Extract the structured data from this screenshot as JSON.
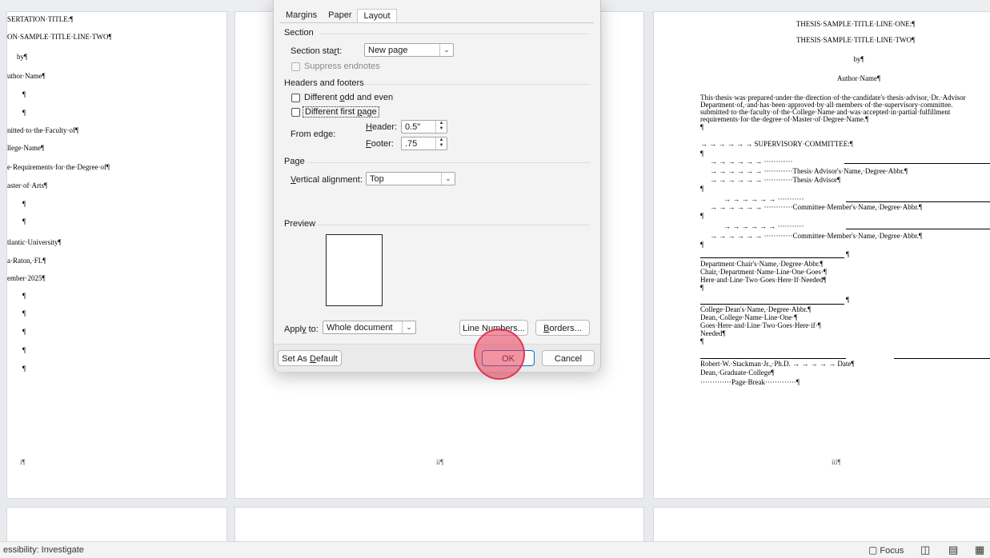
{
  "left_page": {
    "lines": [
      "SERTATION·TITLE:¶",
      "ON·SAMPLE·TITLE·LINE·TWO¶",
      "by¶",
      "uthor·Name¶",
      "¶",
      "¶",
      "nitted·to·the·Faculty·of¶",
      "llege·Name¶",
      "e·Requirements·for·the·Degree·of¶",
      "aster·of·Arts¶",
      "¶",
      "¶",
      "tlantic·University¶",
      "a·Raton,·FL¶",
      "ember·2025¶",
      "¶",
      "¶",
      "¶",
      "¶",
      "¶"
    ],
    "page_number": "i¶"
  },
  "middle_page": {
    "page_number": "ii¶"
  },
  "right_page": {
    "title1": "THESIS·SAMPLE·TITLE·LINE·ONE:¶",
    "title2": "THESIS·SAMPLE·TITLE·LINE·TWO¶",
    "by": "by¶",
    "author": "Author·Name¶",
    "para": [
      "This·thesis·was·prepared·under·the·direction·of·the·candidate's·thesis·advisor,·Dr.·Advisor",
      "Department·of,·and·has·been·approved·by·all·members·of·the·supervisory·committee.",
      "submitted·to·the·faculty·of·the·College·Name·and·was·accepted·in·partial·fulfillment",
      "requirements·for·the·degree·of·Master·of·Degree·Name.¶"
    ],
    "pilcrow": "¶",
    "committee": "→    →    →    →    →    →    SUPERVISORY·COMMITTEE:¶",
    "tabs_dots": "→    →    →    →    →    →    ············",
    "advisor": "→    →    →    →    →    →    ············Thesis·Advisor's·Name,·Degree·Abbr.¶",
    "advisor2": "→    →    →    →    →    →    ············Thesis·Advisor¶",
    "member_dots": "→    →    →    →    →    →    ···········",
    "member": "→    →    →    →    →    →    ············Committee·Member's·Name,·Degree·Abbr.¶",
    "dept_chair": [
      "Department·Chair's·Name,·Degree·Abbr.¶",
      "Chair,·Department·Name·Line·One·Goes·¶",
      "Here·and·Line·Two·Goes·Here·If·Needed¶"
    ],
    "dean": [
      "College·Dean's·Name,·Degree·Abbr.¶",
      "Dean,·College·Name·Line·One·¶",
      "Goes·Here·and·Line·Two·Goes·Here·if·¶",
      "Needed¶"
    ],
    "grad_dean_row": "Robert·W.·Stackman·Jr.,·Ph.D.   →    →    →    →    →   Date¶",
    "grad_dean2": "Dean,·Graduate·College¶",
    "page_break": "·············Page·Break·············¶",
    "page_number": "iii¶"
  },
  "dialog": {
    "tabs": [
      "Margins",
      "Paper",
      "Layout"
    ],
    "section": {
      "title": "Section",
      "start_label": "Section start:",
      "start_value": "New page",
      "suppress_label": "Suppress endnotes"
    },
    "headers": {
      "title": "Headers and footers",
      "odd_even_label": "Different odd and even",
      "first_page_label": "Different first page",
      "from_edge_label": "From edge:",
      "header_label": "Header:",
      "header_value": "0.5\"",
      "footer_label": "Footer:",
      "footer_value": ".75"
    },
    "page": {
      "title": "Page",
      "valign_label": "Vertical alignment:",
      "valign_value": "Top"
    },
    "preview": {
      "title": "Preview",
      "apply_label": "Apply to:",
      "apply_value": "Whole document",
      "line_numbers": "Line Numbers...",
      "borders": "Borders..."
    },
    "buttons": {
      "default": "Set As Default",
      "ok": "OK",
      "cancel": "Cancel"
    }
  },
  "status": {
    "accessibility": "essibility: Investigate",
    "focus": "Focus"
  },
  "colors": {
    "accent": "#0f6cbd",
    "click_marker": "#e83c5a"
  }
}
